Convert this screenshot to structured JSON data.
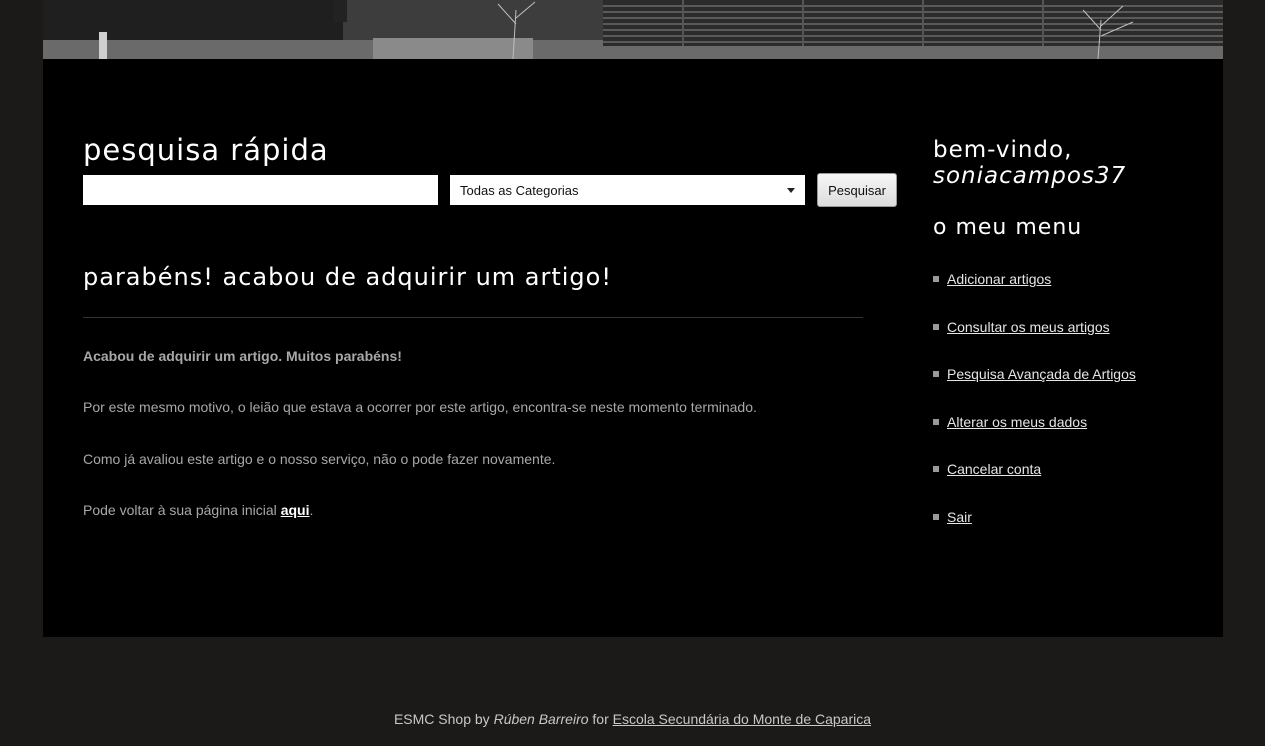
{
  "search": {
    "title": "pesquisa rápida",
    "input_value": "",
    "category_selected": "Todas as Categorias",
    "button_label": "Pesquisar"
  },
  "content": {
    "title": "parabéns! acabou de adquirir um artigo!",
    "paragraph_bold": "Acabou de adquirir um artigo. Muitos parabéns!",
    "paragraph_2": "Por este mesmo motivo, o leião que estava a ocorrer por este artigo, encontra-se neste momento terminado.",
    "paragraph_3": "Como já avaliou este artigo e o nosso serviço, não o pode fazer novamente.",
    "paragraph_4_prefix": "Pode voltar à sua página inicial ",
    "paragraph_4_link": "aqui",
    "paragraph_4_suffix": "."
  },
  "sidebar": {
    "welcome": "bem-vindo,",
    "username": "soniacampos37",
    "menu_title": "o meu menu",
    "items": [
      {
        "label": "Adicionar artigos"
      },
      {
        "label": "Consultar os meus artigos"
      },
      {
        "label": "Pesquisa Avançada de Artigos"
      },
      {
        "label": "Alterar os meus dados"
      },
      {
        "label": "Cancelar conta"
      },
      {
        "label": "Sair"
      }
    ]
  },
  "footer": {
    "prefix": "ESMC Shop by ",
    "author": "Rúben Barreiro",
    "middle": " for ",
    "link": "Escola Secundária do Monte de Caparica"
  },
  "colors": {
    "page_background": "#1b1a18",
    "panel_background": "#000000",
    "heading_text": "#ffffff",
    "body_text": "#a8a8a8"
  }
}
